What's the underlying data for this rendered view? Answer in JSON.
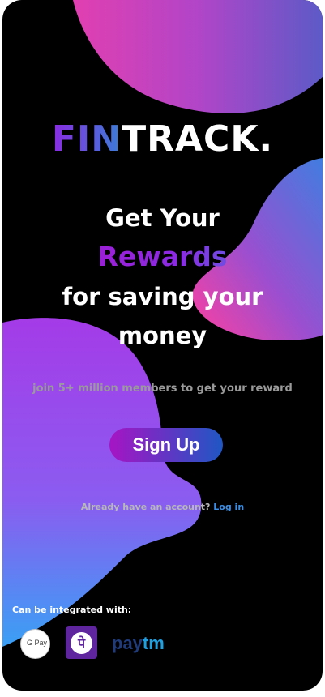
{
  "app": {
    "logo_part1": "FIN",
    "logo_part2": "TRACK."
  },
  "hero": {
    "line1": "Get Your",
    "line2": "Rewards",
    "line3": "for saving your",
    "line4": "money"
  },
  "subtitle": "join 5+ million members to get your reward",
  "signup_label": "Sign Up",
  "login": {
    "prompt": "Already have an account?",
    "link": "Log in"
  },
  "integrations": {
    "title": "Can be integrated with:",
    "items": [
      {
        "name": "gpay-icon",
        "label": "G Pay"
      },
      {
        "name": "phonepe-icon",
        "label": "पे"
      },
      {
        "name": "paytm-icon",
        "part1": "pay",
        "part2": "tm"
      }
    ]
  },
  "colors": {
    "background": "#000000",
    "accent_purple": "#a614c4",
    "accent_blue": "#1f57c4",
    "link": "#3a8ee6"
  }
}
